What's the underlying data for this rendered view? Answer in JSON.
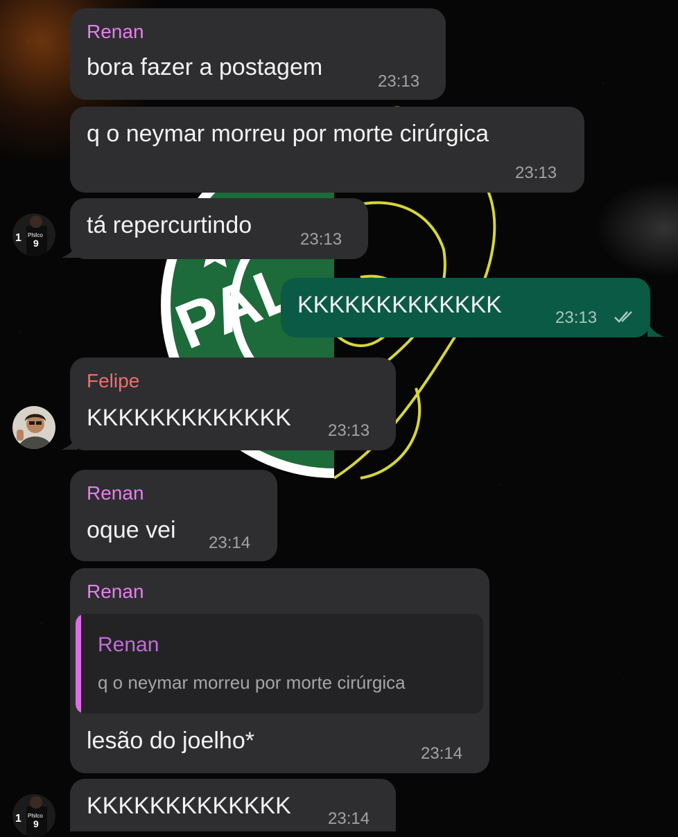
{
  "colors": {
    "renan": "#e77ef0",
    "felipe": "#f06e6e",
    "quote_sender": "#c26fd6",
    "quote_bar": "#de6ee8",
    "incoming_bubble": "#2e2e30",
    "outgoing_bubble": "#0b5a45"
  },
  "messages": [
    {
      "sender": "Renan",
      "text": "bora fazer a postagem",
      "time": "23:13"
    },
    {
      "text": "q o neymar morreu por morte cirúrgica",
      "time": "23:13"
    },
    {
      "text": "tá repercurtindo",
      "time": "23:13",
      "avatar": "player-avatar"
    },
    {
      "text": "KKKKKKKKKKKKK",
      "time": "23:13",
      "outgoing": true,
      "status": "read-double-check-icon"
    },
    {
      "sender": "Felipe",
      "text": "KKKKKKKKKKKKK",
      "time": "23:13",
      "avatar": "person-avatar"
    },
    {
      "sender": "Renan",
      "text": "oque vei",
      "time": "23:14"
    },
    {
      "sender": "Renan",
      "quote": {
        "sender": "Renan",
        "text": "q o neymar morreu por morte cirúrgica"
      },
      "text": "lesão do joelho*",
      "time": "23:14"
    },
    {
      "text": "KKKKKKKKKKKKK",
      "time": "23:14",
      "avatar": "player-avatar"
    }
  ],
  "wallpaper": {
    "crest_text": "PAL",
    "avatar_player_text": "Philco",
    "avatar_player_number": "9",
    "avatar_player_side": "1"
  }
}
